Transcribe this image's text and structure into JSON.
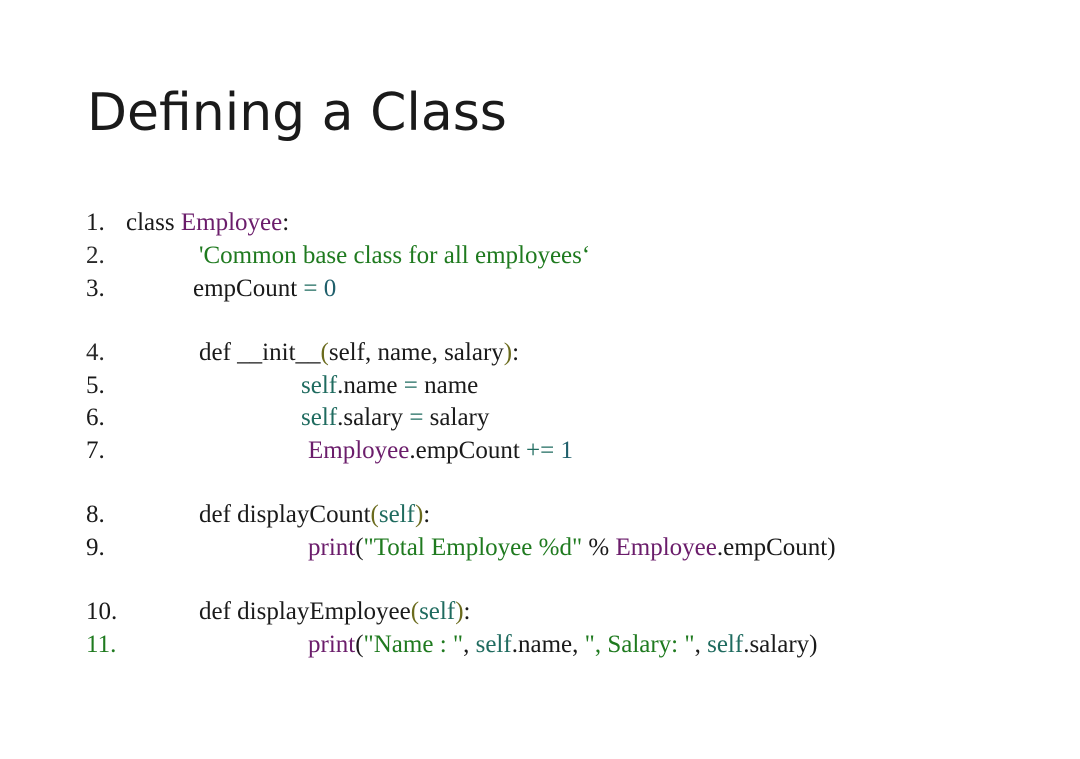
{
  "title": "Defining a Class",
  "colors": {
    "plain": "#1a1a1a",
    "class_name": "#6b1d6b",
    "string": "#1f7a1f",
    "number": "#1f5f6b",
    "operator": "#1f6b5f",
    "paren": "#6b6b1d"
  },
  "code_lines": [
    {
      "num": "1.",
      "tokens": [
        {
          "t": "class ",
          "k": "plain"
        },
        {
          "t": "Employee",
          "k": "class"
        },
        {
          "t": ":",
          "k": "plain"
        }
      ]
    },
    {
      "num": "2.",
      "tokens": [
        {
          "t": "'Common base class for all employees‘",
          "k": "str"
        }
      ]
    },
    {
      "num": "3.",
      "tokens": [
        {
          "t": "empCount ",
          "k": "plain"
        },
        {
          "t": "=",
          "k": "op"
        },
        {
          "t": " 0",
          "k": "num"
        }
      ]
    },
    {
      "num": "4.",
      "tokens": [
        {
          "t": "def ",
          "k": "plain"
        },
        {
          "t": "__init__",
          "k": "plain"
        },
        {
          "t": "(",
          "k": "paren"
        },
        {
          "t": "self, name, salary",
          "k": "plain"
        },
        {
          "t": ")",
          "k": "paren"
        },
        {
          "t": ":",
          "k": "plain"
        }
      ]
    },
    {
      "num": "5.",
      "tokens": [
        {
          "t": "self",
          "k": "op"
        },
        {
          "t": ".name ",
          "k": "plain"
        },
        {
          "t": "=",
          "k": "op"
        },
        {
          "t": " name",
          "k": "plain"
        }
      ]
    },
    {
      "num": "6.",
      "tokens": [
        {
          "t": "self",
          "k": "op"
        },
        {
          "t": ".salary ",
          "k": "plain"
        },
        {
          "t": "=",
          "k": "op"
        },
        {
          "t": " salary",
          "k": "plain"
        }
      ]
    },
    {
      "num": "7.",
      "tokens": [
        {
          "t": "Employee",
          "k": "class"
        },
        {
          "t": ".empCount ",
          "k": "plain"
        },
        {
          "t": "+=",
          "k": "op"
        },
        {
          "t": " 1",
          "k": "num"
        }
      ]
    },
    {
      "num": "8.",
      "tokens": [
        {
          "t": "def ",
          "k": "plain"
        },
        {
          "t": "displayCount",
          "k": "plain"
        },
        {
          "t": "(",
          "k": "paren"
        },
        {
          "t": "self",
          "k": "op"
        },
        {
          "t": ")",
          "k": "paren"
        },
        {
          "t": ":",
          "k": "plain"
        }
      ]
    },
    {
      "num": "9.",
      "tokens": [
        {
          "t": "print",
          "k": "class"
        },
        {
          "t": "(",
          "k": "plain"
        },
        {
          "t": "\"Total Employee %d\"",
          "k": "str"
        },
        {
          "t": " % ",
          "k": "plain"
        },
        {
          "t": "Employee",
          "k": "class"
        },
        {
          "t": ".empCount)",
          "k": "plain"
        }
      ]
    },
    {
      "num": "10.",
      "tokens": [
        {
          "t": "def ",
          "k": "plain"
        },
        {
          "t": "displayEmployee",
          "k": "plain"
        },
        {
          "t": "(",
          "k": "paren"
        },
        {
          "t": "self",
          "k": "op"
        },
        {
          "t": ")",
          "k": "paren"
        },
        {
          "t": ":",
          "k": "plain"
        }
      ]
    },
    {
      "num": "11.",
      "tokens": [
        {
          "t": "print",
          "k": "class"
        },
        {
          "t": "(",
          "k": "plain"
        },
        {
          "t": "\"Name : \"",
          "k": "str"
        },
        {
          "t": ", ",
          "k": "plain"
        },
        {
          "t": "self",
          "k": "op"
        },
        {
          "t": ".name, ",
          "k": "plain"
        },
        {
          "t": "\", Salary: \"",
          "k": "str"
        },
        {
          "t": ", ",
          "k": "plain"
        },
        {
          "t": "self",
          "k": "op"
        },
        {
          "t": ".salary)",
          "k": "plain"
        }
      ]
    }
  ]
}
